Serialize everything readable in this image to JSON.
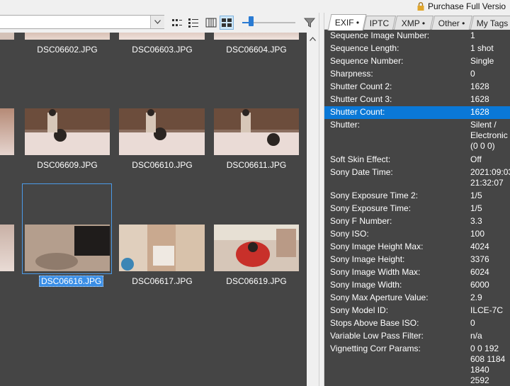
{
  "topbar": {
    "purchase_text": "Purchase Full Versio"
  },
  "toolbar": {
    "icons": [
      "grid-dots-icon",
      "list-view-icon",
      "columns-view-icon",
      "thumbnail-view-icon"
    ],
    "zoom_level": 0.12
  },
  "grid": {
    "row1": [
      "DSC06602.JPG",
      "DSC06603.JPG",
      "DSC06604.JPG"
    ],
    "row2": [
      "DSC06609.JPG",
      "DSC06610.JPG",
      "DSC06611.JPG"
    ],
    "row3": [
      "DSC06616.JPG",
      "DSC06617.JPG",
      "DSC06619.JPG"
    ]
  },
  "tabs": [
    {
      "label": "EXIF •",
      "active": true
    },
    {
      "label": "IPTC",
      "active": false
    },
    {
      "label": "XMP •",
      "active": false
    },
    {
      "label": "Other •",
      "active": false
    },
    {
      "label": "My Tags",
      "active": false
    }
  ],
  "properties": [
    {
      "name": "Sequence Image Number:",
      "value": "1"
    },
    {
      "name": "Sequence Length:",
      "value": "1 shot"
    },
    {
      "name": "Sequence Number:",
      "value": "Single"
    },
    {
      "name": "Sharpness:",
      "value": "0"
    },
    {
      "name": "Shutter Count 2:",
      "value": "1628"
    },
    {
      "name": "Shutter Count 3:",
      "value": "1628"
    },
    {
      "name": "Shutter Count:",
      "value": "1628",
      "selected": true
    },
    {
      "name": "Shutter:",
      "value": "Silent /\nElectronic\n(0 0 0)"
    },
    {
      "name": "Soft Skin Effect:",
      "value": "Off"
    },
    {
      "name": "Sony Date Time:",
      "value": "2021:09:03\n21:32:07"
    },
    {
      "name": "Sony Exposure Time 2:",
      "value": "1/5"
    },
    {
      "name": "Sony Exposure Time:",
      "value": "1/5"
    },
    {
      "name": "Sony F Number:",
      "value": "3.3"
    },
    {
      "name": "Sony ISO:",
      "value": "100"
    },
    {
      "name": "Sony Image Height Max:",
      "value": "4024"
    },
    {
      "name": "Sony Image Height:",
      "value": "3376"
    },
    {
      "name": "Sony Image Width Max:",
      "value": "6024"
    },
    {
      "name": "Sony Image Width:",
      "value": "6000"
    },
    {
      "name": "Sony Max Aperture Value:",
      "value": "2.9"
    },
    {
      "name": "Sony Model ID:",
      "value": "ILCE-7C"
    },
    {
      "name": "Stops Above Base ISO:",
      "value": "0"
    },
    {
      "name": "Variable Low Pass Filter:",
      "value": "n/a"
    },
    {
      "name": "Vignetting Corr Params:",
      "value": "0 0 192\n608 1184\n1840\n2592"
    }
  ],
  "colors": {
    "background": "#454545",
    "selection": "#0a78d7",
    "accent": "#2a7bd3"
  }
}
